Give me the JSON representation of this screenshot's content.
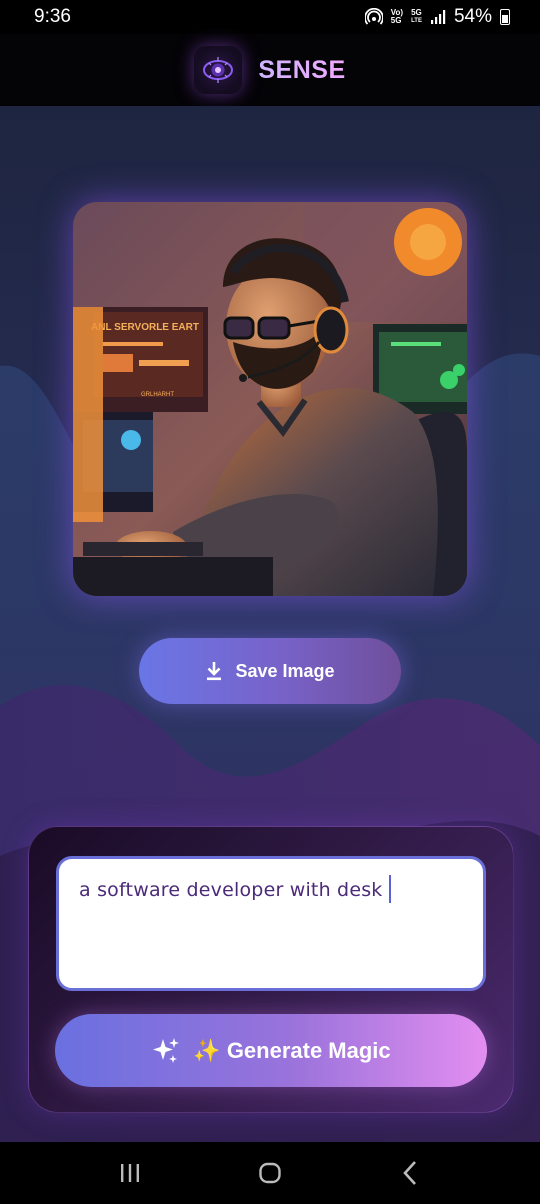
{
  "status_bar": {
    "time": "9:36",
    "network_top": "Vo)",
    "network_bottom": "5G",
    "network2_top": "5G",
    "network2_bottom": "LTE",
    "battery": "54%"
  },
  "header": {
    "app_title": "SENSE",
    "logo_icon": "eye-logo-icon"
  },
  "main": {
    "generated_image": {
      "alt": "software developer with headphones at desk",
      "screen_text": "ANL SERVORLE EART",
      "screen_text2": "GRLHARHT"
    },
    "save_button": {
      "label": "Save Image",
      "icon": "download-icon"
    },
    "prompt": {
      "value": "a software developer with desk"
    },
    "generate_button": {
      "label": "✨ Generate Magic",
      "icon": "sparkles-icon"
    }
  },
  "nav_bar": {
    "recents_icon": "recents-icon",
    "home_icon": "home-icon",
    "back_icon": "back-icon"
  },
  "colors": {
    "accent_blue": "#6a70e0",
    "accent_pink": "#e38ef0",
    "background": "#262c52"
  }
}
